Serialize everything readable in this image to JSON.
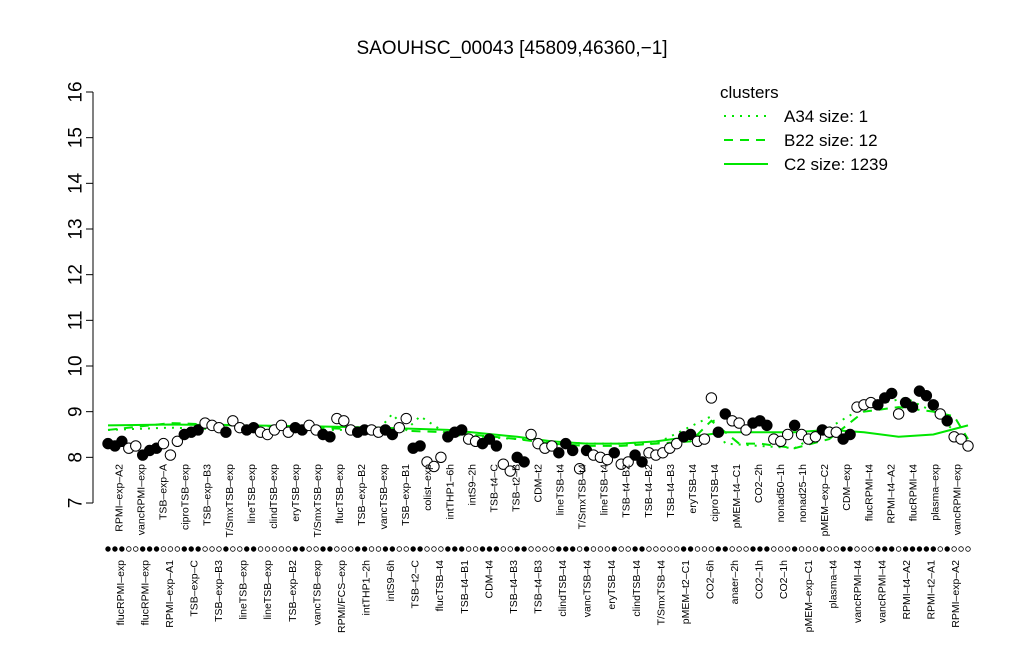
{
  "chart_data": {
    "type": "scatter",
    "title": "SAOUHSC_00043 [45809,46360,−1]",
    "xlabel": "",
    "ylabel": "",
    "ylim": [
      7,
      16
    ],
    "yticks": [
      7,
      8,
      9,
      10,
      11,
      12,
      13,
      14,
      15,
      16
    ],
    "grid": false,
    "legend_position": "top-right",
    "legend": {
      "title": "clusters",
      "color": "#00e600",
      "entries": [
        {
          "label": "A34 size: 1",
          "style": "dotted"
        },
        {
          "label": "B22 size: 12",
          "style": "dashed"
        },
        {
          "label": "C2 size: 1239",
          "style": "solid"
        }
      ]
    },
    "x_labels_top": [
      "RPMI–exp–A2",
      "vancRPMI–exp",
      "TSB–exp–A",
      "ciproTSB–exp",
      "TSB–exp–B3",
      "T/SmxTSB–exp",
      "lineTSB–exp",
      "clindTSB–exp",
      "eryTSB–exp",
      "T/SmxTSB–exp",
      "flucTSB–exp",
      "TSB–exp–B2",
      "vancTSB–exp",
      "TSB–exp–B1",
      "colist–exp",
      "intTHP1–6h",
      "intS9–2h",
      "TSB–t4–C",
      "TSB–t2–B",
      "CDM–t2",
      "lineTSB–t4",
      "T/SmxTSB–t4",
      "lineTSB–t4",
      "TSB–t4–B2",
      "TSB–t4–B2",
      "TSB–t4–B3",
      "eryTSB–t4",
      "ciproTSB–t4",
      "pMEM–t4–C1",
      "CO2–2h",
      "nonad50–1h",
      "nonad25–1h",
      "pMEM–exp–C2",
      "CDM–exp",
      "flucRPMI–t4",
      "RPMI–t4–A2",
      "flucRPMI–t4",
      "plasma–exp",
      "vancRPMI–exp"
    ],
    "x_labels_bottom": [
      "flucRPMI–exp",
      "flucRPMI–exp",
      "RPMI–exp–A1",
      "TSB–exp–C",
      "TSB–exp–B3",
      "lineTSB–exp",
      "lineTSB–exp",
      "TSB–exp–B2",
      "vancTSB–exp",
      "RPMI/FCS–exp",
      "intTHP1–2h",
      "intS9–6h",
      "TSB–t2–C",
      "flucTSB–t4",
      "TSB–t4–B1",
      "CDM–t4",
      "TSB–t4–B3",
      "TSB–t4–B3",
      "clindTSB–t4",
      "vancTSB–t4",
      "eryTSB–t4",
      "clindTSB–t4",
      "T/SmxTSB–t4",
      "pMEM–t2–C1",
      "CO2–6h",
      "anaer–2h",
      "CO2–1h",
      "CO2–1h",
      "pMEM–exp–C1",
      "plasma–t4",
      "vancRPMI–t4",
      "vancRPMI–t4",
      "RPMI–t4–A2",
      "RPMI–t2–A1",
      "RPMI–exp–A2"
    ],
    "points": [
      {
        "x": 1,
        "y": 8.3,
        "filled": true
      },
      {
        "x": 2,
        "y": 8.25,
        "filled": true
      },
      {
        "x": 3,
        "y": 8.35,
        "filled": true
      },
      {
        "x": 4,
        "y": 8.2,
        "filled": false
      },
      {
        "x": 5,
        "y": 8.25,
        "filled": false
      },
      {
        "x": 6,
        "y": 8.05,
        "filled": true
      },
      {
        "x": 7,
        "y": 8.15,
        "filled": true
      },
      {
        "x": 8,
        "y": 8.2,
        "filled": true
      },
      {
        "x": 9,
        "y": 8.3,
        "filled": false
      },
      {
        "x": 10,
        "y": 8.05,
        "filled": false
      },
      {
        "x": 11,
        "y": 8.35,
        "filled": false
      },
      {
        "x": 12,
        "y": 8.5,
        "filled": true
      },
      {
        "x": 13,
        "y": 8.55,
        "filled": true
      },
      {
        "x": 14,
        "y": 8.6,
        "filled": true
      },
      {
        "x": 15,
        "y": 8.75,
        "filled": false
      },
      {
        "x": 16,
        "y": 8.7,
        "filled": false
      },
      {
        "x": 17,
        "y": 8.65,
        "filled": false
      },
      {
        "x": 18,
        "y": 8.55,
        "filled": true
      },
      {
        "x": 19,
        "y": 8.8,
        "filled": false
      },
      {
        "x": 20,
        "y": 8.65,
        "filled": false
      },
      {
        "x": 21,
        "y": 8.6,
        "filled": true
      },
      {
        "x": 22,
        "y": 8.65,
        "filled": true
      },
      {
        "x": 23,
        "y": 8.55,
        "filled": false
      },
      {
        "x": 24,
        "y": 8.5,
        "filled": false
      },
      {
        "x": 25,
        "y": 8.6,
        "filled": false
      },
      {
        "x": 26,
        "y": 8.7,
        "filled": false
      },
      {
        "x": 27,
        "y": 8.55,
        "filled": false
      },
      {
        "x": 28,
        "y": 8.65,
        "filled": true
      },
      {
        "x": 29,
        "y": 8.6,
        "filled": true
      },
      {
        "x": 30,
        "y": 8.7,
        "filled": false
      },
      {
        "x": 31,
        "y": 8.6,
        "filled": false
      },
      {
        "x": 32,
        "y": 8.5,
        "filled": true
      },
      {
        "x": 33,
        "y": 8.45,
        "filled": true
      },
      {
        "x": 34,
        "y": 8.85,
        "filled": false
      },
      {
        "x": 35,
        "y": 8.8,
        "filled": false
      },
      {
        "x": 36,
        "y": 8.6,
        "filled": false
      },
      {
        "x": 37,
        "y": 8.55,
        "filled": true
      },
      {
        "x": 38,
        "y": 8.6,
        "filled": true
      },
      {
        "x": 39,
        "y": 8.6,
        "filled": false
      },
      {
        "x": 40,
        "y": 8.55,
        "filled": false
      },
      {
        "x": 41,
        "y": 8.6,
        "filled": true
      },
      {
        "x": 42,
        "y": 8.5,
        "filled": true
      },
      {
        "x": 43,
        "y": 8.65,
        "filled": false
      },
      {
        "x": 44,
        "y": 8.85,
        "filled": false
      },
      {
        "x": 45,
        "y": 8.2,
        "filled": true
      },
      {
        "x": 46,
        "y": 8.25,
        "filled": true
      },
      {
        "x": 47,
        "y": 7.9,
        "filled": false
      },
      {
        "x": 48,
        "y": 7.8,
        "filled": false
      },
      {
        "x": 49,
        "y": 8.0,
        "filled": false
      },
      {
        "x": 50,
        "y": 8.45,
        "filled": true
      },
      {
        "x": 51,
        "y": 8.55,
        "filled": true
      },
      {
        "x": 52,
        "y": 8.6,
        "filled": true
      },
      {
        "x": 53,
        "y": 8.4,
        "filled": false
      },
      {
        "x": 54,
        "y": 8.35,
        "filled": false
      },
      {
        "x": 55,
        "y": 8.3,
        "filled": true
      },
      {
        "x": 56,
        "y": 8.4,
        "filled": true
      },
      {
        "x": 57,
        "y": 8.25,
        "filled": true
      },
      {
        "x": 58,
        "y": 7.85,
        "filled": false
      },
      {
        "x": 59,
        "y": 7.7,
        "filled": false
      },
      {
        "x": 60,
        "y": 8.0,
        "filled": true
      },
      {
        "x": 61,
        "y": 7.9,
        "filled": true
      },
      {
        "x": 62,
        "y": 8.5,
        "filled": false
      },
      {
        "x": 63,
        "y": 8.3,
        "filled": false
      },
      {
        "x": 64,
        "y": 8.2,
        "filled": false
      },
      {
        "x": 65,
        "y": 8.25,
        "filled": false
      },
      {
        "x": 66,
        "y": 8.1,
        "filled": true
      },
      {
        "x": 67,
        "y": 8.3,
        "filled": true
      },
      {
        "x": 68,
        "y": 8.15,
        "filled": true
      },
      {
        "x": 69,
        "y": 7.75,
        "filled": false
      },
      {
        "x": 70,
        "y": 8.15,
        "filled": true
      },
      {
        "x": 71,
        "y": 8.05,
        "filled": false
      },
      {
        "x": 72,
        "y": 8.0,
        "filled": false
      },
      {
        "x": 73,
        "y": 7.95,
        "filled": false
      },
      {
        "x": 74,
        "y": 8.1,
        "filled": true
      },
      {
        "x": 75,
        "y": 7.85,
        "filled": false
      },
      {
        "x": 76,
        "y": 7.9,
        "filled": false
      },
      {
        "x": 77,
        "y": 8.05,
        "filled": true
      },
      {
        "x": 78,
        "y": 7.9,
        "filled": true
      },
      {
        "x": 79,
        "y": 8.1,
        "filled": false
      },
      {
        "x": 80,
        "y": 8.05,
        "filled": false
      },
      {
        "x": 81,
        "y": 8.1,
        "filled": false
      },
      {
        "x": 82,
        "y": 8.2,
        "filled": false
      },
      {
        "x": 83,
        "y": 8.3,
        "filled": false
      },
      {
        "x": 84,
        "y": 8.45,
        "filled": true
      },
      {
        "x": 85,
        "y": 8.5,
        "filled": true
      },
      {
        "x": 86,
        "y": 8.35,
        "filled": false
      },
      {
        "x": 87,
        "y": 8.4,
        "filled": false
      },
      {
        "x": 88,
        "y": 9.3,
        "filled": false
      },
      {
        "x": 89,
        "y": 8.55,
        "filled": true
      },
      {
        "x": 90,
        "y": 8.95,
        "filled": true
      },
      {
        "x": 91,
        "y": 8.8,
        "filled": false
      },
      {
        "x": 92,
        "y": 8.75,
        "filled": false
      },
      {
        "x": 93,
        "y": 8.6,
        "filled": false
      },
      {
        "x": 94,
        "y": 8.75,
        "filled": true
      },
      {
        "x": 95,
        "y": 8.8,
        "filled": true
      },
      {
        "x": 96,
        "y": 8.7,
        "filled": true
      },
      {
        "x": 97,
        "y": 8.4,
        "filled": false
      },
      {
        "x": 98,
        "y": 8.35,
        "filled": false
      },
      {
        "x": 99,
        "y": 8.5,
        "filled": false
      },
      {
        "x": 100,
        "y": 8.7,
        "filled": true
      },
      {
        "x": 101,
        "y": 8.5,
        "filled": false
      },
      {
        "x": 102,
        "y": 8.4,
        "filled": false
      },
      {
        "x": 103,
        "y": 8.45,
        "filled": false
      },
      {
        "x": 104,
        "y": 8.6,
        "filled": true
      },
      {
        "x": 105,
        "y": 8.55,
        "filled": false
      },
      {
        "x": 106,
        "y": 8.55,
        "filled": false
      },
      {
        "x": 107,
        "y": 8.4,
        "filled": true
      },
      {
        "x": 108,
        "y": 8.5,
        "filled": true
      },
      {
        "x": 109,
        "y": 9.1,
        "filled": false
      },
      {
        "x": 110,
        "y": 9.15,
        "filled": false
      },
      {
        "x": 111,
        "y": 9.2,
        "filled": false
      },
      {
        "x": 112,
        "y": 9.15,
        "filled": true
      },
      {
        "x": 113,
        "y": 9.3,
        "filled": true
      },
      {
        "x": 114,
        "y": 9.4,
        "filled": true
      },
      {
        "x": 115,
        "y": 8.95,
        "filled": false
      },
      {
        "x": 116,
        "y": 9.2,
        "filled": true
      },
      {
        "x": 117,
        "y": 9.1,
        "filled": true
      },
      {
        "x": 118,
        "y": 9.45,
        "filled": true
      },
      {
        "x": 119,
        "y": 9.35,
        "filled": true
      },
      {
        "x": 120,
        "y": 9.15,
        "filled": true
      },
      {
        "x": 121,
        "y": 8.95,
        "filled": false
      },
      {
        "x": 122,
        "y": 8.8,
        "filled": true
      },
      {
        "x": 123,
        "y": 8.45,
        "filled": false
      },
      {
        "x": 124,
        "y": 8.4,
        "filled": false
      },
      {
        "x": 125,
        "y": 8.25,
        "filled": false
      }
    ],
    "lines": [
      {
        "name": "C2 size: 1239",
        "style": "solid",
        "x": [
          1,
          10,
          20,
          30,
          40,
          50,
          60,
          65,
          70,
          75,
          80,
          85,
          90,
          95,
          100,
          105,
          110,
          115,
          120,
          125
        ],
        "y": [
          8.7,
          8.72,
          8.7,
          8.68,
          8.65,
          8.6,
          8.45,
          8.35,
          8.3,
          8.3,
          8.35,
          8.45,
          8.55,
          8.55,
          8.55,
          8.6,
          8.55,
          8.45,
          8.5,
          8.7
        ]
      },
      {
        "name": "B22 size: 12",
        "style": "dashed",
        "x": [
          1,
          10,
          20,
          30,
          40,
          50,
          60,
          65,
          70,
          75,
          80,
          85,
          88,
          92,
          95,
          100,
          105,
          110,
          115,
          120,
          123,
          125
        ],
        "y": [
          8.6,
          8.75,
          8.7,
          8.65,
          8.6,
          8.55,
          8.4,
          8.3,
          8.25,
          8.25,
          8.3,
          8.35,
          8.8,
          8.3,
          8.3,
          8.2,
          8.4,
          9.0,
          9.1,
          9.0,
          8.9,
          8.4
        ]
      },
      {
        "name": "A34 size: 1",
        "style": "dotted",
        "x": [
          1,
          10,
          20,
          30,
          40,
          42,
          44,
          46,
          50,
          60,
          70,
          80,
          88,
          90,
          100,
          110,
          116,
          120,
          125
        ],
        "y": [
          8.6,
          8.65,
          8.6,
          8.6,
          8.6,
          8.95,
          8.6,
          8.9,
          8.5,
          8.4,
          8.3,
          8.3,
          8.9,
          8.3,
          8.2,
          9.1,
          9.3,
          9.0,
          8.3
        ]
      }
    ]
  }
}
